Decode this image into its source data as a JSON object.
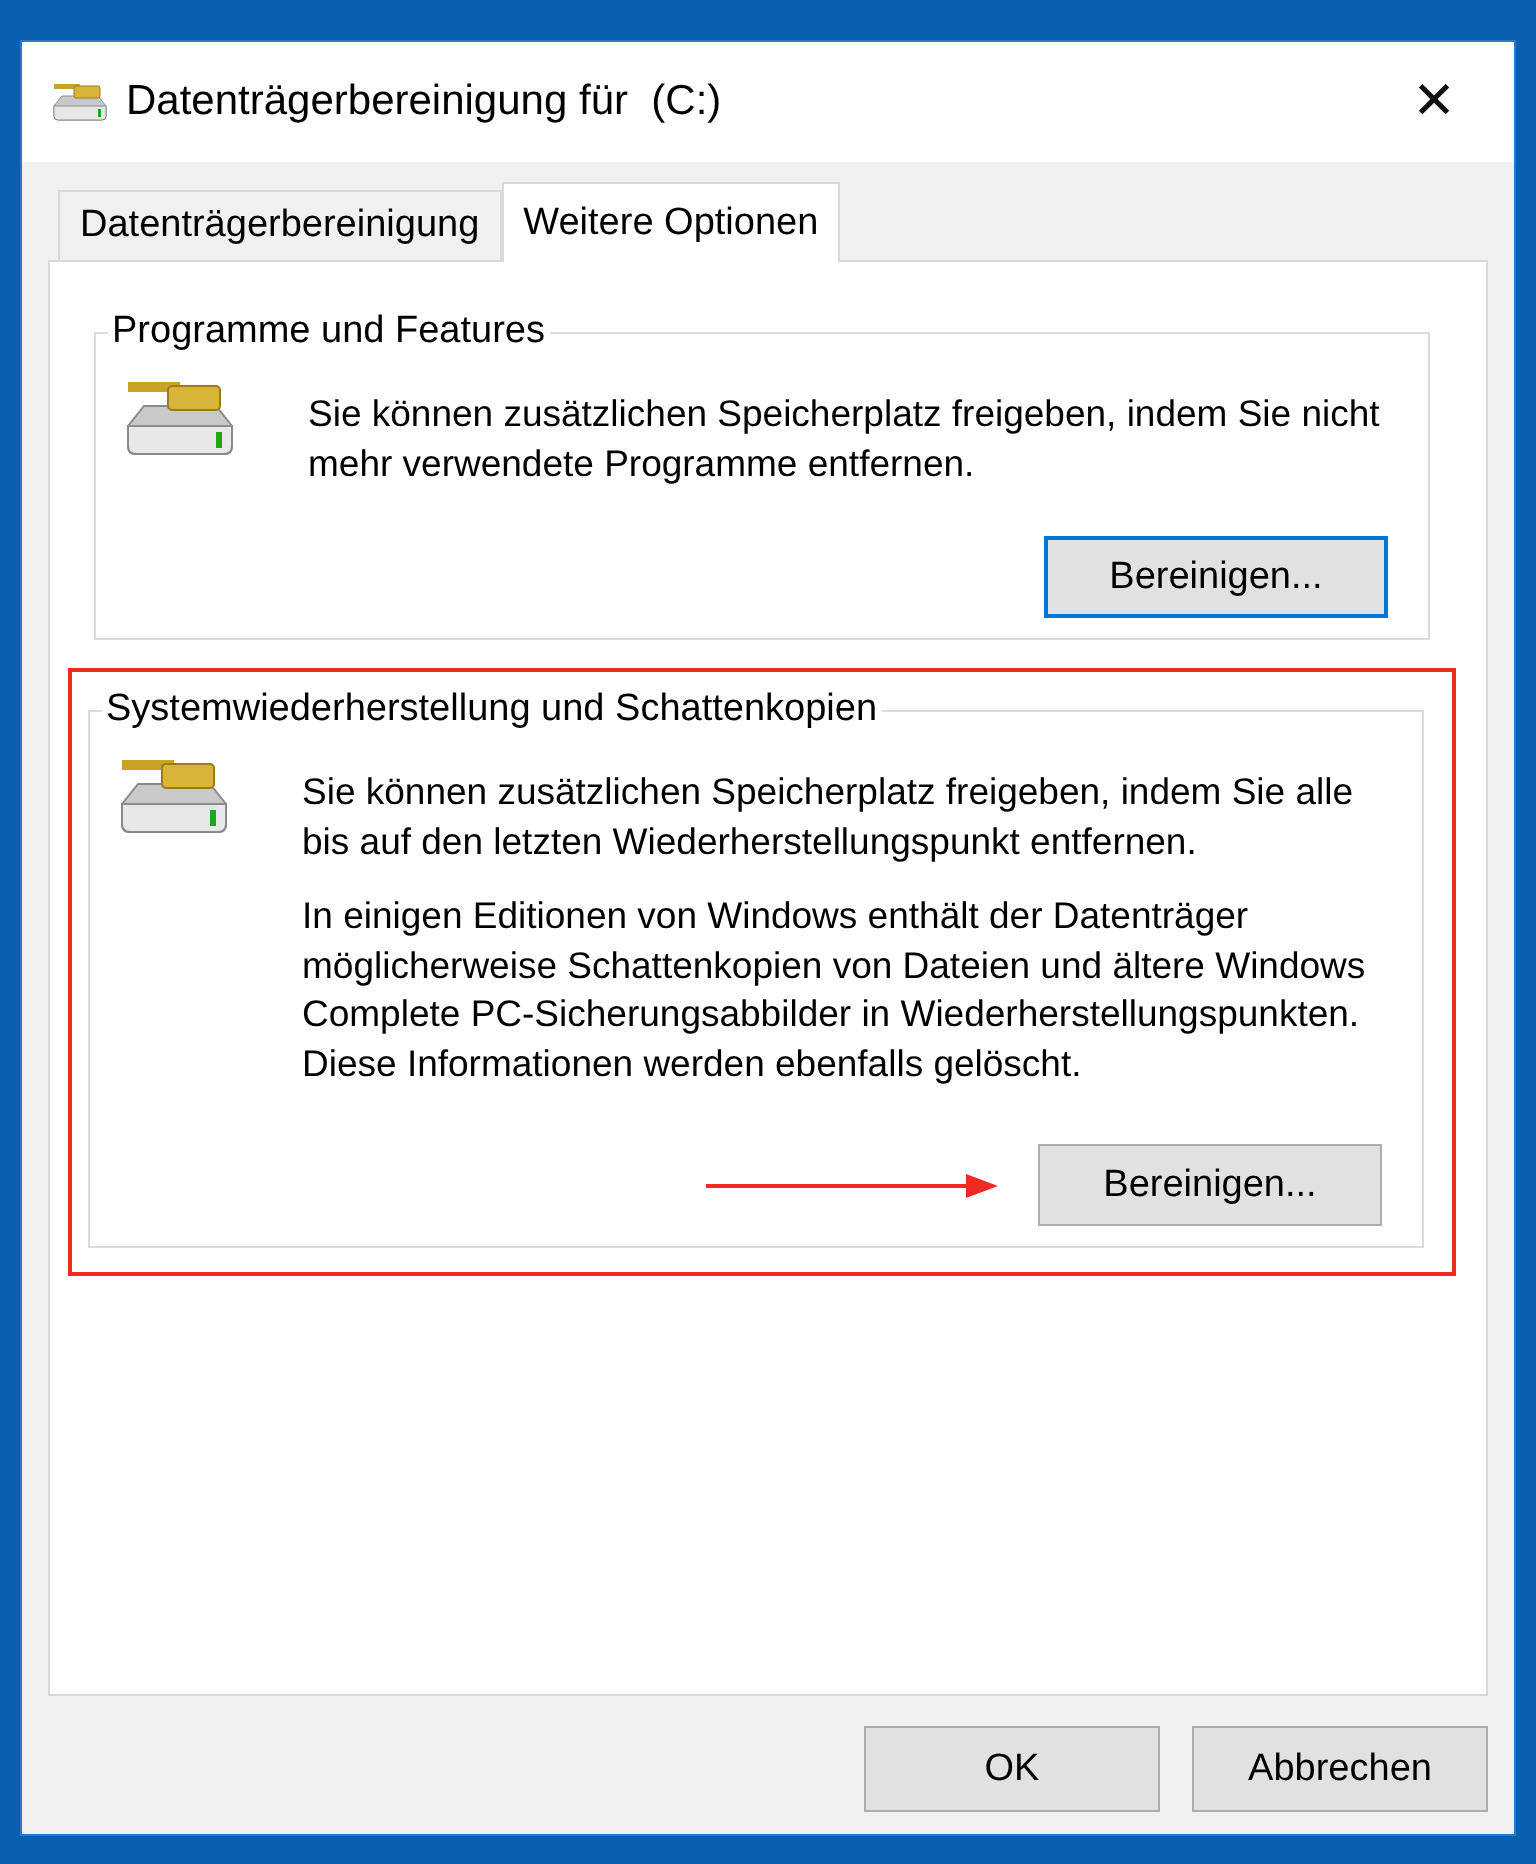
{
  "window": {
    "title": "Datenträgerbereinigung für  (C:)",
    "close": "✕"
  },
  "tabs": [
    {
      "label": "Datenträgerbereinigung",
      "selected": false
    },
    {
      "label": "Weitere Optionen",
      "selected": true
    }
  ],
  "groups": [
    {
      "title": "Programme und Features",
      "paragraphs": [
        "Sie können zusätzlichen Speicherplatz freigeben, indem Sie nicht mehr verwendete Programme entfernen."
      ],
      "button": {
        "label": "Bereinigen...",
        "default": true
      },
      "highlighted": false
    },
    {
      "title": "Systemwiederherstellung und Schattenkopien",
      "paragraphs": [
        "Sie können zusätzlichen Speicherplatz freigeben, indem Sie alle bis auf den letzten Wiederherstellungspunkt entfernen.",
        "In einigen Editionen von Windows enthält der Datenträger möglicherweise Schattenkopien von Dateien und ältere Windows Complete PC-Sicherungsabbilder in Wiederherstellungspunkten. Diese Informationen werden ebenfalls gelöscht."
      ],
      "button": {
        "label": "Bereinigen...",
        "default": false
      },
      "highlighted": true
    }
  ],
  "buttons": [
    {
      "label": "OK"
    },
    {
      "label": "Abbrechen"
    }
  ]
}
